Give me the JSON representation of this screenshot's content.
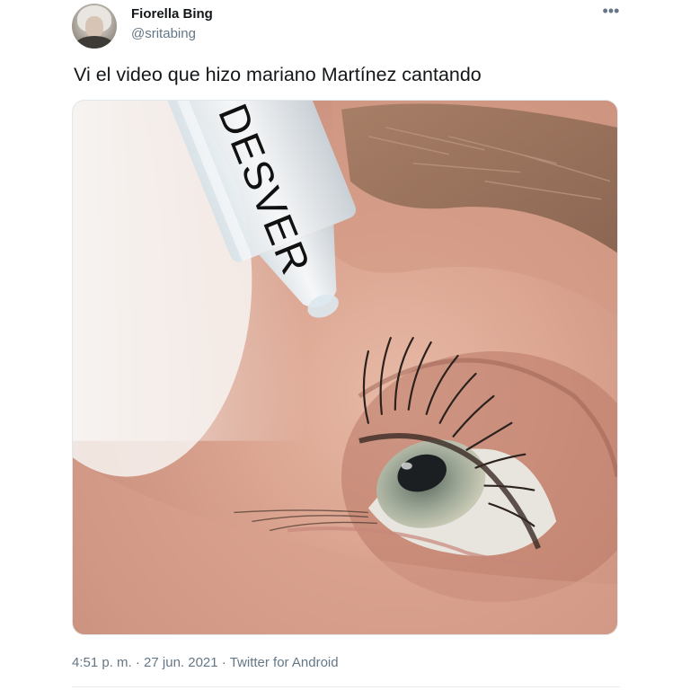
{
  "author": {
    "display_name": "Fiorella Bing",
    "handle": "@sritabing",
    "avatar_icon": "profile-photo"
  },
  "menu": {
    "icon": "more-options-icon",
    "glyph": "•••"
  },
  "tweet": {
    "text": "Vi el video que hizo mariano Martínez cantando"
  },
  "media": {
    "dropper_label": "DESVER"
  },
  "meta": {
    "time": "4:51 p. m.",
    "separator": "·",
    "date": "27 jun. 2021",
    "source": "Twitter for Android"
  },
  "colors": {
    "text_primary": "#14171a",
    "text_secondary": "#657786",
    "border": "#e1e8ed"
  }
}
